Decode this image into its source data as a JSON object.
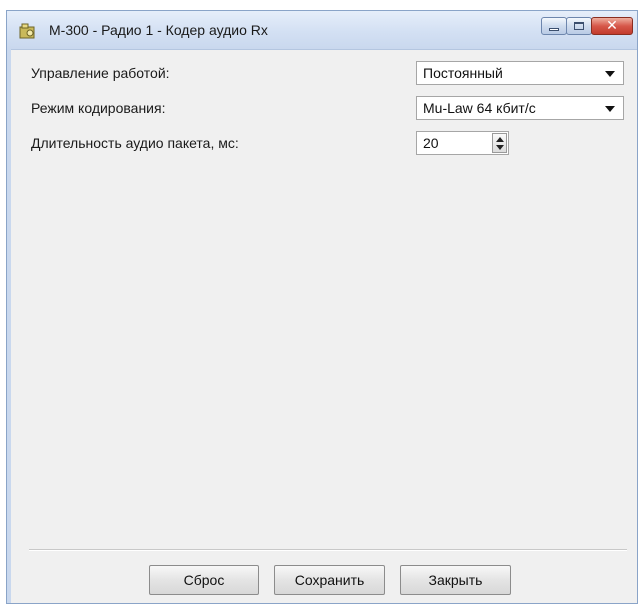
{
  "window": {
    "title": "М-300 - Радио 1 - Кодер аудио Rx",
    "icon": "radio-app-icon",
    "controls": {
      "minimize": "minimize-icon",
      "maximize": "maximize-icon",
      "close": "✕"
    }
  },
  "form": {
    "operation_control": {
      "label": "Управление работой:",
      "value": "Постоянный"
    },
    "encoding_mode": {
      "label": "Режим кодирования:",
      "value": "Mu-Law 64 кбит/с"
    },
    "packet_duration": {
      "label": "Длительность аудио пакета, мс:",
      "value": "20"
    }
  },
  "buttons": {
    "reset": "Сброс",
    "save": "Сохранить",
    "close": "Закрыть"
  },
  "colors": {
    "titlebar": "#d3e0f3",
    "client_background": "#f0f0f0",
    "close_button": "#c23b2c"
  }
}
